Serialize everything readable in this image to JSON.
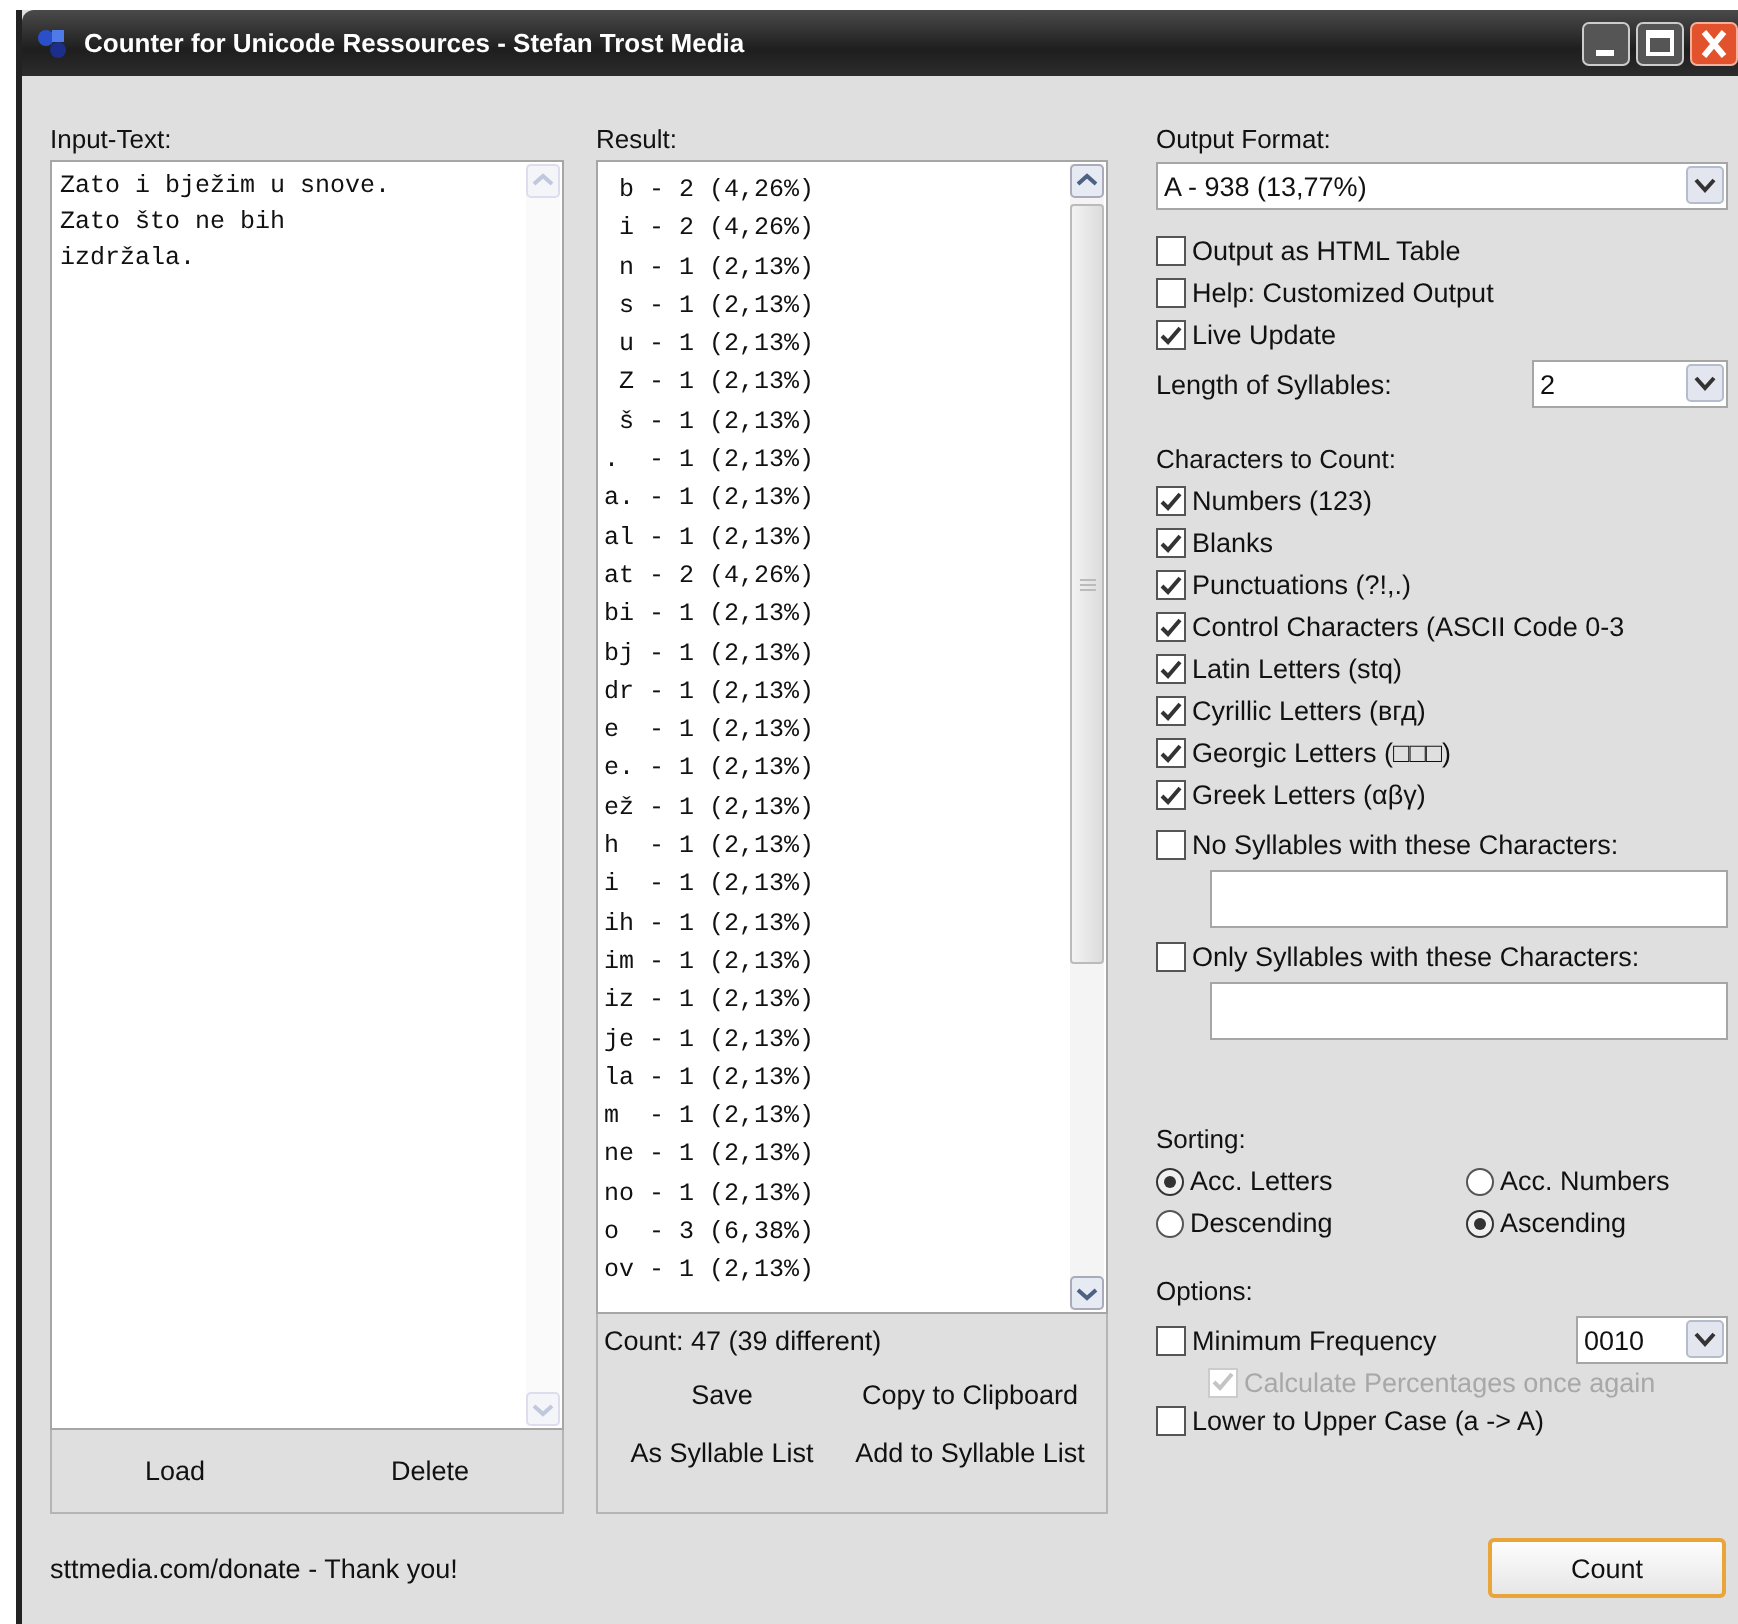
{
  "window": {
    "title": "Counter for Unicode Ressources - Stefan Trost Media"
  },
  "input": {
    "label": "Input-Text:",
    "value": "Zato i bježim u snove.\nZato što ne bih\nizdržala.",
    "buttons": [
      "Load",
      "Delete"
    ]
  },
  "result": {
    "label": "Result:",
    "rows": [
      " b - 2 (4,26%)",
      " i - 2 (4,26%)",
      " n - 1 (2,13%)",
      " s - 1 (2,13%)",
      " u - 1 (2,13%)",
      " Z - 1 (2,13%)",
      " š - 1 (2,13%)",
      ".  - 1 (2,13%)",
      "a. - 1 (2,13%)",
      "al - 1 (2,13%)",
      "at - 2 (4,26%)",
      "bi - 1 (2,13%)",
      "bj - 1 (2,13%)",
      "dr - 1 (2,13%)",
      "e  - 1 (2,13%)",
      "e. - 1 (2,13%)",
      "ež - 1 (2,13%)",
      "h  - 1 (2,13%)",
      "i  - 1 (2,13%)",
      "ih - 1 (2,13%)",
      "im - 1 (2,13%)",
      "iz - 1 (2,13%)",
      "je - 1 (2,13%)",
      "la - 1 (2,13%)",
      "m  - 1 (2,13%)",
      "ne - 1 (2,13%)",
      "no - 1 (2,13%)",
      "o  - 3 (6,38%)",
      "ov - 1 (2,13%)"
    ],
    "count": "Count: 47 (39 different)",
    "buttons": [
      "Save",
      "Copy to Clipboard",
      "As Syllable List",
      "Add to Syllable List"
    ]
  },
  "output_format": {
    "label": "Output Format:",
    "value": "A - 938 (13,77%)"
  },
  "settings": [
    {
      "label": "Output as HTML Table",
      "checked": false
    },
    {
      "label": "Help: Customized Output",
      "checked": false
    },
    {
      "label": "Live Update",
      "checked": true
    }
  ],
  "syllable_length": {
    "label": "Length of Syllables:",
    "value": "2"
  },
  "characters": {
    "label": "Characters to Count:",
    "items": [
      {
        "label": "Numbers (123)",
        "checked": true
      },
      {
        "label": "Blanks",
        "checked": true
      },
      {
        "label": "Punctuations (?!,.)",
        "checked": true
      },
      {
        "label": "Control Characters (ASCII Code 0-3",
        "checked": true
      },
      {
        "label": "Latin Letters (stq)",
        "checked": true
      },
      {
        "label": "Cyrillic Letters (вгд)",
        "checked": true
      },
      {
        "label": "Georgic Letters (□□□)",
        "checked": true
      },
      {
        "label": "Greek Letters (αβγ)",
        "checked": true
      }
    ]
  },
  "filters": [
    {
      "label": "No Syllables with these Characters:",
      "checked": false
    },
    {
      "label": "Only Syllables with these Characters:",
      "checked": false
    }
  ],
  "sorting": {
    "label": "Sorting:",
    "groups": [
      [
        {
          "label": "Acc. Letters",
          "selected": true
        },
        {
          "label": "Acc. Numbers",
          "selected": false
        }
      ],
      [
        {
          "label": "Descending",
          "selected": false
        },
        {
          "label": "Ascending",
          "selected": true
        }
      ]
    ]
  },
  "options": {
    "label": "Options:",
    "minimum_frequency": {
      "label": "Minimum Frequency",
      "checked": false,
      "value": "0010"
    },
    "recalculate": {
      "label": "Calculate Percentages once again",
      "checked": true,
      "disabled": true
    },
    "upper_case": {
      "label": "Lower to Upper Case (a -> A)",
      "checked": false
    }
  },
  "status": "sttmedia.com/donate - Thank you!",
  "count_button": "Count"
}
